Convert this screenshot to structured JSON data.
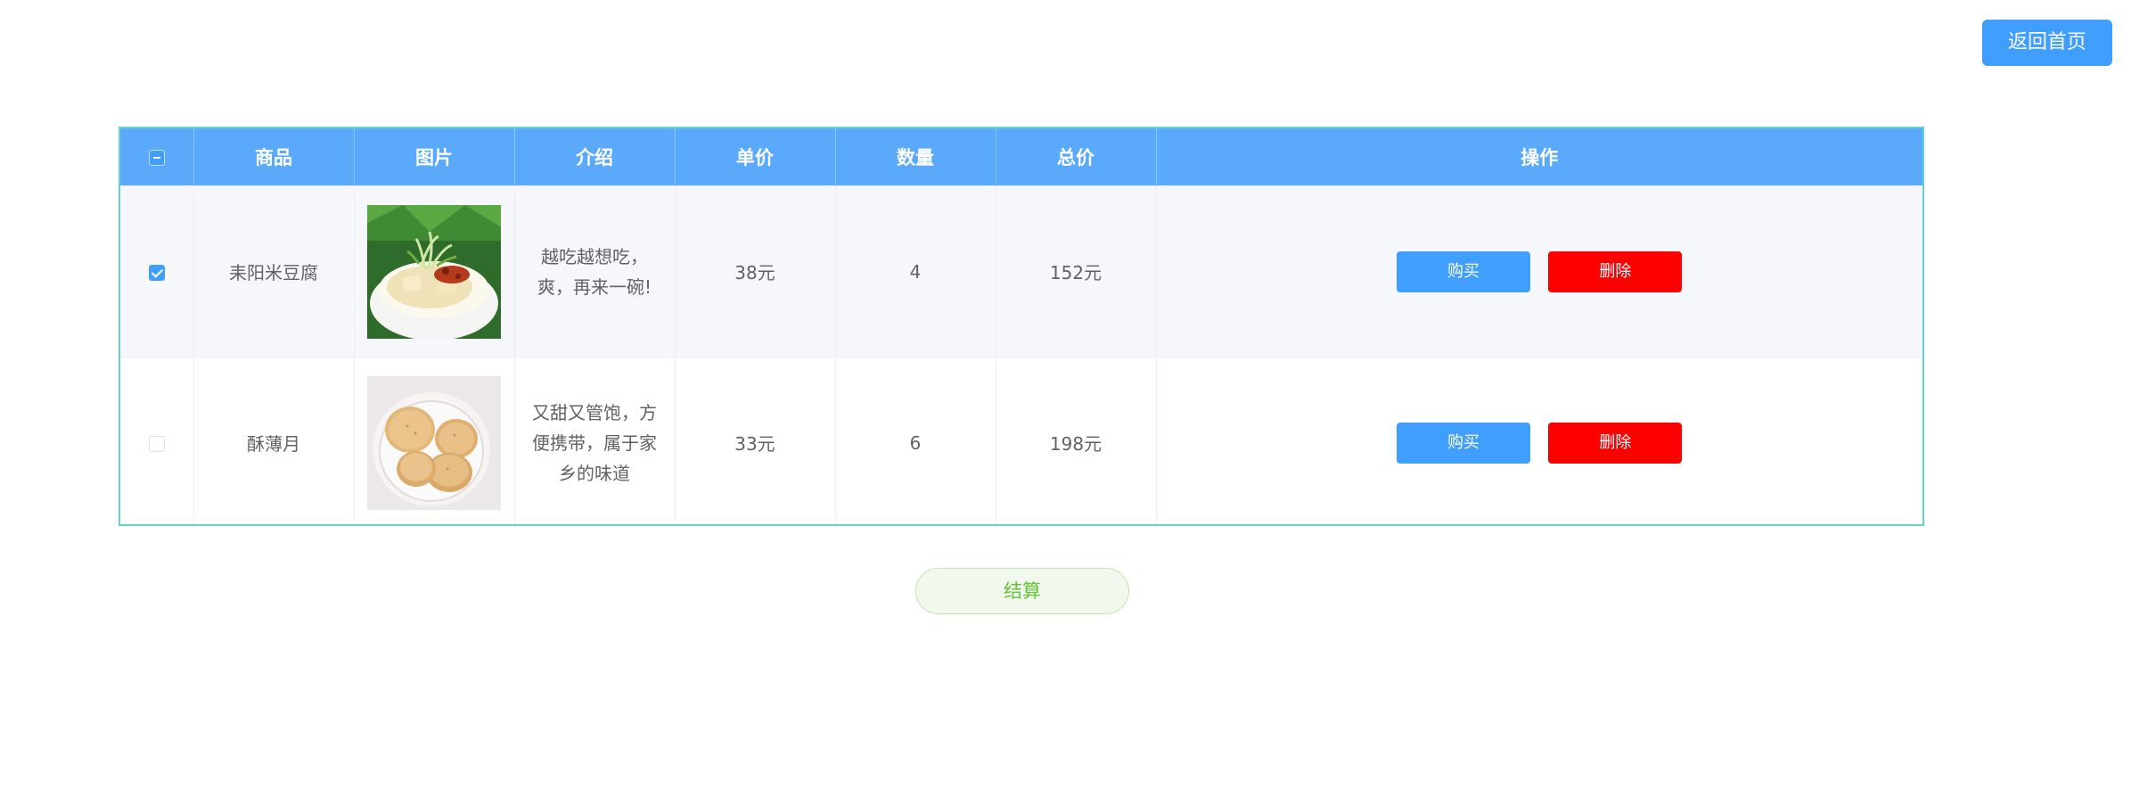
{
  "header": {
    "home_button": "返回首页"
  },
  "table": {
    "columns": [
      "商品",
      "图片",
      "介绍",
      "单价",
      "数量",
      "总价",
      "操作"
    ],
    "select_all_state": "indeterminate",
    "rows": [
      {
        "checked": true,
        "name": "耒阳米豆腐",
        "image_icon": "rice-tofu-dish-image",
        "intro": "越吃越想吃，爽，再来一碗!",
        "unit_price": "38元",
        "quantity": "4",
        "total": "152元",
        "buy_label": "购买",
        "delete_label": "删除"
      },
      {
        "checked": false,
        "name": "酥薄月",
        "image_icon": "mooncake-biscuit-image",
        "intro": "又甜又管饱，方便携带，属于家乡的味道",
        "unit_price": "33元",
        "quantity": "6",
        "total": "198元",
        "buy_label": "购买",
        "delete_label": "删除"
      }
    ]
  },
  "footer": {
    "checkout_label": "结算"
  },
  "colors": {
    "primary": "#409eff",
    "header_bg": "#5aa9fb",
    "danger": "#ff0000",
    "success": "#67c23a",
    "table_border": "#66d3cf"
  }
}
